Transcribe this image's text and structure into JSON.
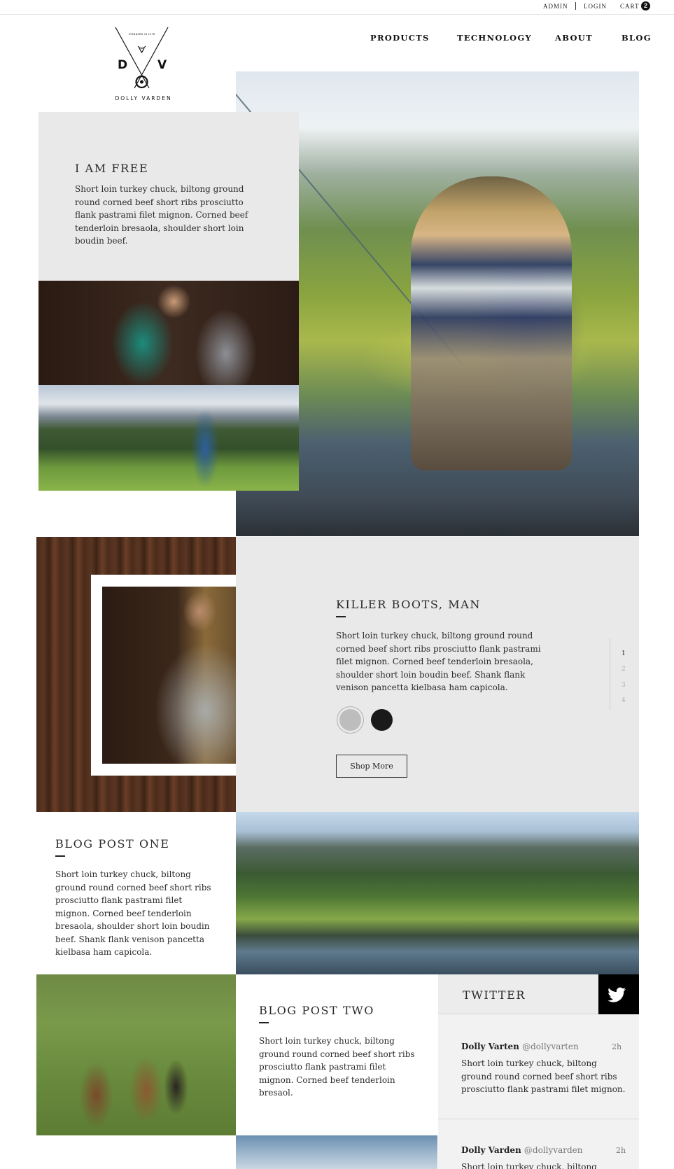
{
  "utility_bar": {
    "admin": "ADMIN",
    "login": "LOGIN",
    "cart": "CART",
    "cart_count": "2"
  },
  "brand": {
    "name": "DOLLY VARDEN",
    "left_letter": "D",
    "right_letter": "V",
    "seal_text": "STANDARD IN 1978",
    "logo_icon": "crossed-rods-logo"
  },
  "nav": {
    "items": [
      "PRODUCTS",
      "TECHNOLOGY",
      "ABOUT",
      "BLOG"
    ]
  },
  "feature_one": {
    "title": "I AM FREE",
    "body": "Short loin turkey chuck, biltong ground round corned beef short ribs prosciutto flank pastrami filet mignon. Corned beef tenderloin bresaola, shoulder short loin boudin beef."
  },
  "feature_two": {
    "title": "KILLER BOOTS, MAN",
    "body": "Short loin turkey chuck, biltong ground round corned beef short ribs prosciutto flank pastrami filet mignon. Corned beef tenderloin bresaola, shoulder short loin boudin beef. Shank flank venison pancetta kielbasa ham capicola.",
    "swatches": [
      "#bdbdbd",
      "#1a1a1a"
    ],
    "button": "Shop More",
    "pager": [
      "1",
      "2",
      "3",
      "4"
    ]
  },
  "blog_one": {
    "title": "BLOG POST ONE",
    "body": "Short loin turkey chuck, biltong ground round corned beef short ribs prosciutto flank pastrami filet mignon. Corned beef tenderloin bresaola, shoulder short loin boudin beef. Shank flank venison pancetta kielbasa ham capicola."
  },
  "blog_two": {
    "title": "BLOG POST TWO",
    "body": "Short loin turkey chuck, biltong ground round corned beef short ribs prosciutto flank pastrami filet mignon. Corned beef tenderloin bresaol."
  },
  "twitter": {
    "title": "TWITTER",
    "icon": "twitter-bird-icon",
    "tweets": [
      {
        "name": "Dolly Varten",
        "handle": "@dollyvarten",
        "time": "2h",
        "text": "Short loin turkey chuck, biltong ground round corned beef short ribs prosciutto flank pastrami filet mignon."
      },
      {
        "name": "Dolly Varden",
        "handle": "@dollyvarden",
        "time": "2h",
        "text": "Short loin turkey chuck, biltong ground"
      }
    ]
  }
}
